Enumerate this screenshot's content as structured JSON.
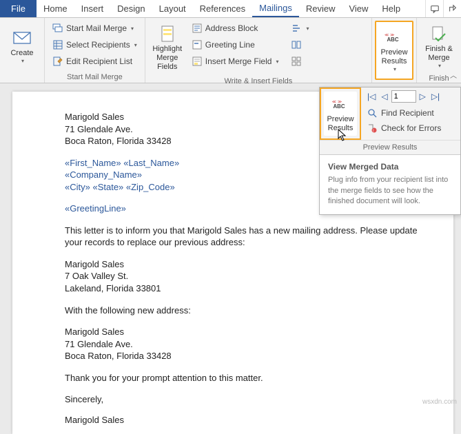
{
  "tabs": {
    "file": "File",
    "list": [
      "Home",
      "Insert",
      "Design",
      "Layout",
      "References",
      "Mailings",
      "Review",
      "View",
      "Help"
    ],
    "active": 5
  },
  "ribbon": {
    "create": {
      "label": "Create"
    },
    "startMerge": {
      "startMailMerge": "Start Mail Merge",
      "selectRecipients": "Select Recipients",
      "editRecipientList": "Edit Recipient List",
      "groupLabel": "Start Mail Merge"
    },
    "writeInsert": {
      "highlightMergeFields": "Highlight\nMerge Fields",
      "addressBlock": "Address Block",
      "greetingLine": "Greeting Line",
      "insertMergeField": "Insert Merge Field",
      "groupLabel": "Write & Insert Fields"
    },
    "preview": {
      "label": "Preview\nResults"
    },
    "finish": {
      "label": "Finish &\nMerge",
      "groupLabel": "Finish"
    }
  },
  "panel": {
    "previewResults": "Preview\nResults",
    "recordValue": "1",
    "findRecipient": "Find Recipient",
    "checkErrors": "Check for Errors",
    "groupLabel": "Preview Results",
    "tipTitle": "View Merged Data",
    "tipBody": "Plug info from your recipient list into the merge fields to see how the finished document will look."
  },
  "doc": {
    "sender1": "Marigold Sales",
    "sender2": "71 Glendale Ave.",
    "sender3": "Boca Raton, Florida 33428",
    "fields1": "«First_Name» «Last_Name»",
    "fields2": "«Company_Name»",
    "fields3": "«City» «State» «Zip_Code»",
    "greeting": "«GreetingLine»",
    "body1": "This letter is to inform you that Marigold Sales has a new mailing address. Please update your records to replace our previous address:",
    "old1": "Marigold Sales",
    "old2": "7 Oak Valley St.",
    "old3": "Lakeland, Florida 33801",
    "withNew": "With the following new address:",
    "new1": "Marigold Sales",
    "new2": "71 Glendale Ave.",
    "new3": "Boca Raton, Florida 33428",
    "thanks": "Thank you for your prompt attention to this matter.",
    "closing": "Sincerely,",
    "sig": "Marigold Sales",
    "watermark": "wsxdn.com"
  }
}
